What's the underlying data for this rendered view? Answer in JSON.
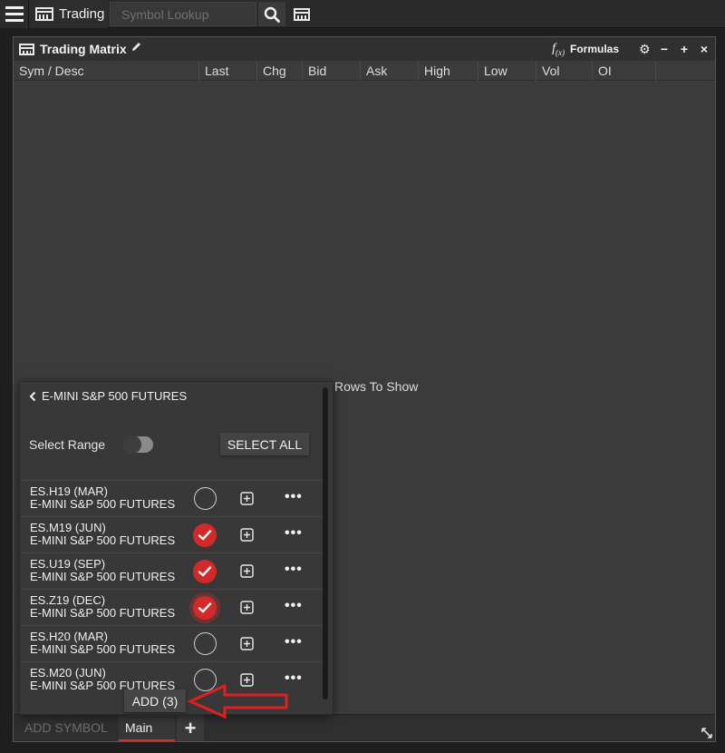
{
  "topbar": {
    "trading_label": "Trading",
    "symbol_placeholder": "Symbol Lookup"
  },
  "window": {
    "title": "Trading Matrix",
    "formulas_label": "Formulas",
    "formula_icon": "f(x)",
    "controls": [
      "gear-icon",
      "minimize-icon",
      "maximize-icon",
      "close-icon"
    ]
  },
  "columns": [
    "Sym / Desc",
    "Last",
    "Chg",
    "Bid",
    "Ask",
    "High",
    "Low",
    "Vol",
    "OI"
  ],
  "empty_message": "Rows To Show",
  "panel": {
    "title": "E-MINI S&P 500 FUTURES",
    "select_range_label": "Select Range",
    "select_range_on": false,
    "select_all_label": "SELECT ALL",
    "add_label": "ADD (3)",
    "contracts": [
      {
        "symbol": "ES.H19 (MAR)",
        "desc": "E-MINI S&P 500 FUTURES",
        "selected": false
      },
      {
        "symbol": "ES.M19 (JUN)",
        "desc": "E-MINI S&P 500 FUTURES",
        "selected": true
      },
      {
        "symbol": "ES.U19 (SEP)",
        "desc": "E-MINI S&P 500 FUTURES",
        "selected": true
      },
      {
        "symbol": "ES.Z19 (DEC)",
        "desc": "E-MINI S&P 500 FUTURES",
        "selected": true
      },
      {
        "symbol": "ES.H20 (MAR)",
        "desc": "E-MINI S&P 500 FUTURES",
        "selected": false
      },
      {
        "symbol": "ES.M20 (JUN)",
        "desc": "E-MINI S&P 500 FUTURES",
        "selected": false
      }
    ]
  },
  "tabs": {
    "add_symbol_label": "ADD SYMBOL",
    "main_label": "Main",
    "plus_label": "+"
  },
  "colors": {
    "accent": "#d22a2a",
    "background": "#3b3b3b"
  }
}
